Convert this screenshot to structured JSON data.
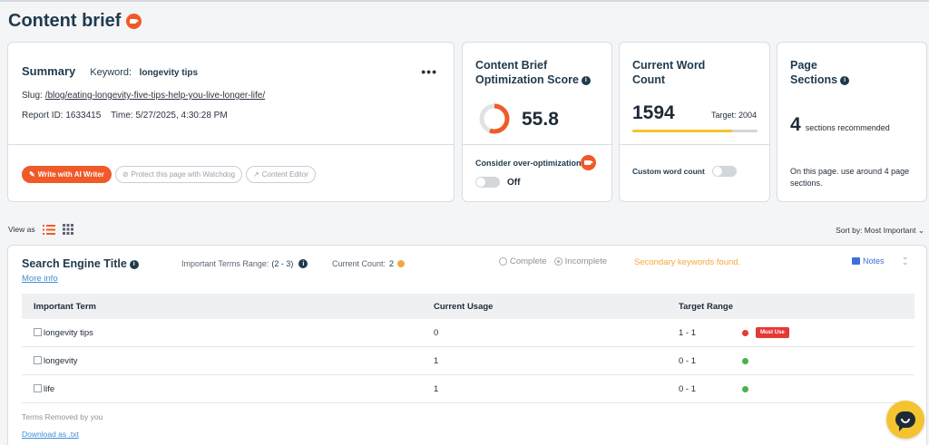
{
  "page": {
    "title": "Content brief"
  },
  "summary": {
    "heading": "Summary",
    "keyword_label": "Keyword:",
    "keyword_value": "longevity tips",
    "slug_label": "Slug:",
    "slug_value": "/blog/eating-longevity-five-tips-help-you-live-longer-life/",
    "report_id": "Report ID: 1633415",
    "time": "Time: 5/27/2025, 4:30:28 PM",
    "buttons": {
      "write": "Write with AI Writer",
      "protect": "Protect this page with Watchdog",
      "editor": "Content Editor"
    }
  },
  "score": {
    "heading_line1": "Content Brief",
    "heading_line2": "Optimization Score",
    "value": "55.8",
    "fraction": 0.558,
    "over_opt_label": "Consider over-optimization",
    "toggle_label": "Off"
  },
  "word_count": {
    "heading_line1": "Current Word",
    "heading_line2": "Count",
    "value": "1594",
    "target": "Target: 2004",
    "progress": 0.795,
    "custom_label": "Custom word count"
  },
  "sections": {
    "heading_line1": "Page",
    "heading_line2": "Sections",
    "count": "4",
    "recommended": "sections recommended",
    "note": "On this page. use around 4 page sections."
  },
  "view": {
    "label": "View as",
    "sort": "Sort by: Most Important"
  },
  "panel": {
    "title": "Search Engine Title",
    "more_info": "More info",
    "range_label": "Important Terms Range:",
    "range_value": "(2 - 3)",
    "count_label": "Current Count:",
    "count_value": "2",
    "complete": "Complete",
    "incomplete": "Incomplete",
    "secondary": "Secondary keywords found.",
    "notes": "Notes",
    "columns": {
      "term": "Important Term",
      "usage": "Current Usage",
      "target": "Target Range"
    },
    "rows": [
      {
        "term": "longevity tips",
        "usage": "0",
        "target": "1 - 1",
        "status": "#e53935",
        "badge": "Must Use"
      },
      {
        "term": "longevity",
        "usage": "1",
        "target": "0 - 1",
        "status": "#4caf50"
      },
      {
        "term": "life",
        "usage": "1",
        "target": "0 - 1",
        "status": "#4caf50"
      }
    ],
    "removed_label": "Terms Removed by you",
    "download": "Download as .txt"
  },
  "colors": {
    "accent": "#f05a28",
    "warning": "#f5a83a",
    "bar": "#f4c430"
  }
}
